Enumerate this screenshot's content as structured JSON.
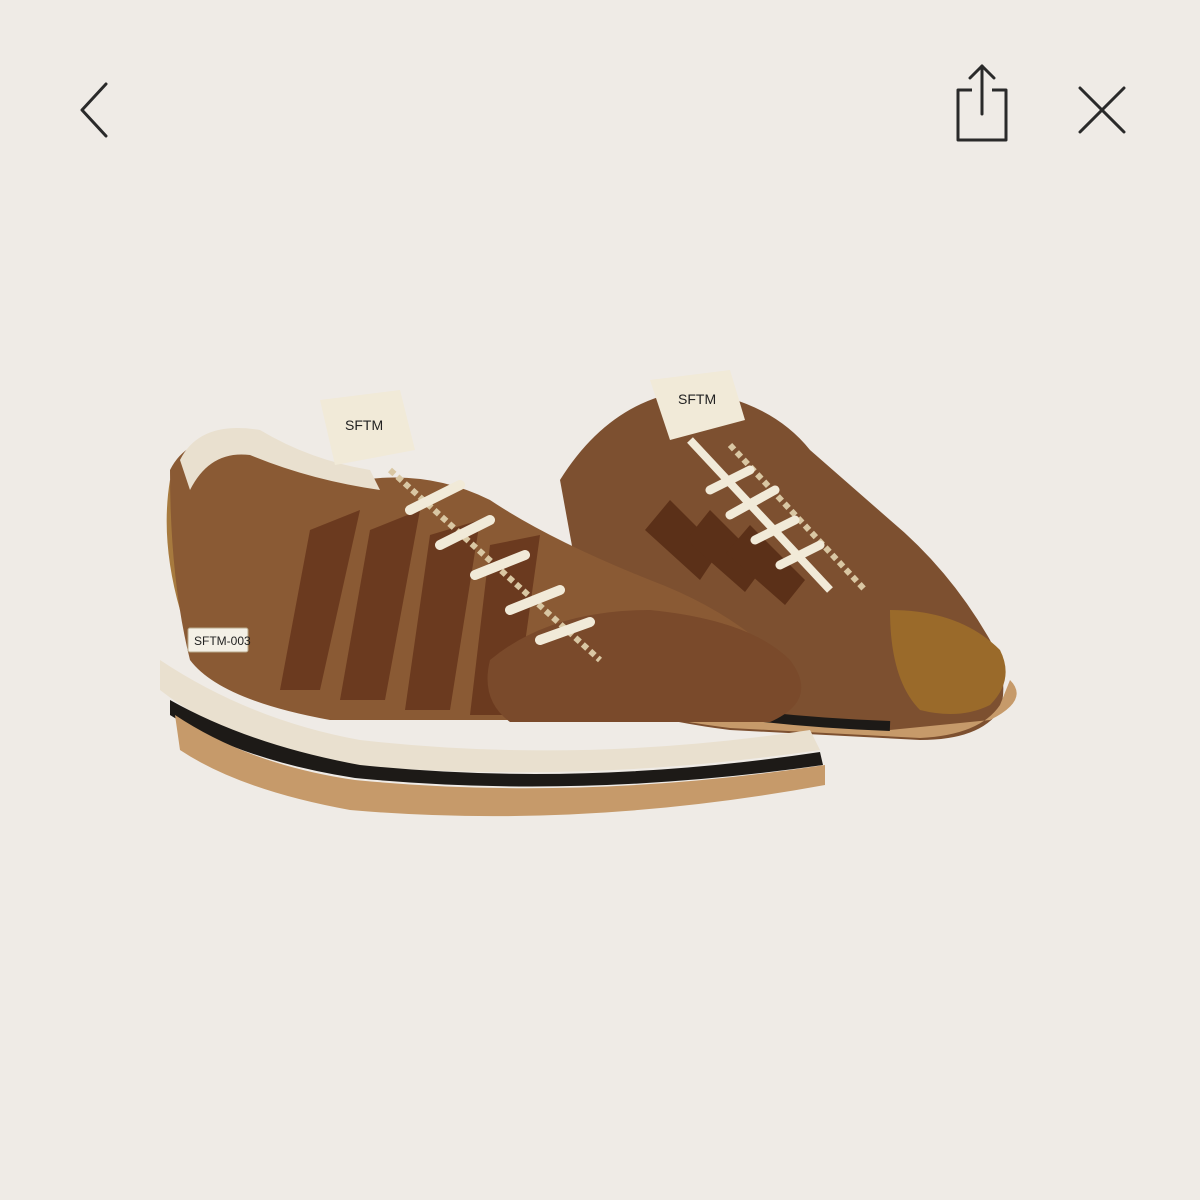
{
  "toolbar": {
    "back_icon": "chevron-left-icon",
    "share_icon": "share-icon",
    "close_icon": "close-icon"
  },
  "image": {
    "alt": "Brown suede sneakers pair",
    "background": "#efebe6",
    "tongue_tag": "SFTM",
    "side_tag": "SFTM-003"
  },
  "colors": {
    "suede": "#8a5a34",
    "stripe": "#6b3a1f",
    "patent": "#9a6a2a",
    "sole_cream": "#e9e0cf",
    "sole_gum": "#c69a6a",
    "sole_black": "#1d1a17",
    "lace": "#f1ead8",
    "icon": "#2a2a2a"
  }
}
